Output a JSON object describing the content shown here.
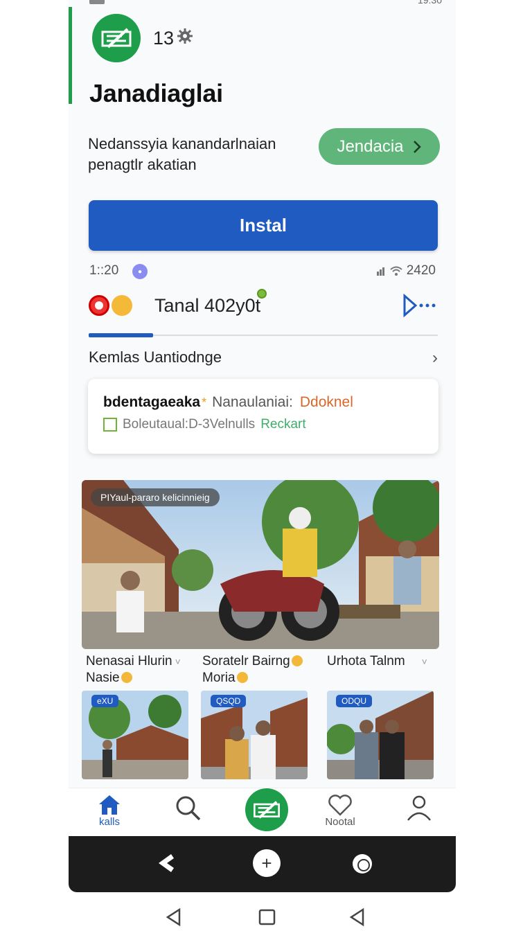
{
  "status_bar": {
    "time": "19:30"
  },
  "app": {
    "number": "13",
    "title": "Janadiaglai",
    "description": "Nedanssyia kanandarlnaian penagtlr akatian",
    "pill_button": "Jendacia",
    "install_button": "Instal"
  },
  "meta": {
    "left": "1::20",
    "right": "2420"
  },
  "tab": {
    "label": "Tanal 402y0t"
  },
  "section": {
    "title": "Kemlas Uantiodnge"
  },
  "info_card": {
    "name": "bdentagaeaka",
    "star": "*",
    "key": "Nanaulaniai:",
    "value": "Ddoknel",
    "line2": "Boleutaual:D-3Velnulls",
    "line2_link": "Reckart"
  },
  "hero": {
    "tag": "PIYaul-pararo kelicinnieig"
  },
  "captions": [
    {
      "line1": "Nenasai Hlurin",
      "line2": "Nasie"
    },
    {
      "line1": "Soratelr Bairng",
      "line2": "Moria"
    },
    {
      "line1": "Urhota Talnm",
      "line2": ""
    }
  ],
  "thumbs": [
    {
      "tag": "eXU"
    },
    {
      "tag": "QSQD"
    },
    {
      "tag": "ODQU"
    }
  ],
  "bottom_nav": {
    "home_label": "kalls",
    "favorites_label": "Nootal"
  },
  "colors": {
    "brand_green": "#1e9e4b",
    "primary_blue": "#1f5bc0",
    "pill_green": "#5fb57a",
    "accent_orange": "#d9662a"
  }
}
